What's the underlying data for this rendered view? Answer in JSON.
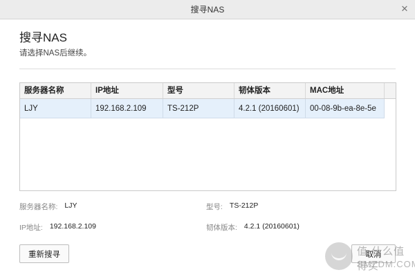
{
  "window": {
    "title": "搜寻NAS"
  },
  "header": {
    "title": "搜寻NAS",
    "subtitle": "请选择NAS后继续。"
  },
  "table": {
    "columns": [
      "服务器名称",
      "IP地址",
      "型号",
      "韧体版本",
      "MAC地址"
    ],
    "rows": [
      [
        "LJY",
        "192.168.2.109",
        "TS-212P",
        "4.2.1 (20160601)",
        "00-08-9b-ea-8e-5e"
      ]
    ]
  },
  "details": {
    "server_name_label": "服务器名称:",
    "server_name_value": "LJY",
    "model_label": "型号:",
    "model_value": "TS-212P",
    "ip_label": "IP地址:",
    "ip_value": "192.168.2.109",
    "firmware_label": "韧体版本:",
    "firmware_value": "4.2.1 (20160601)"
  },
  "buttons": {
    "rescan": "重新搜寻",
    "cancel": "取消"
  },
  "watermark": {
    "line1": "值 什么值得买",
    "line2": "SMZDM.COM"
  }
}
